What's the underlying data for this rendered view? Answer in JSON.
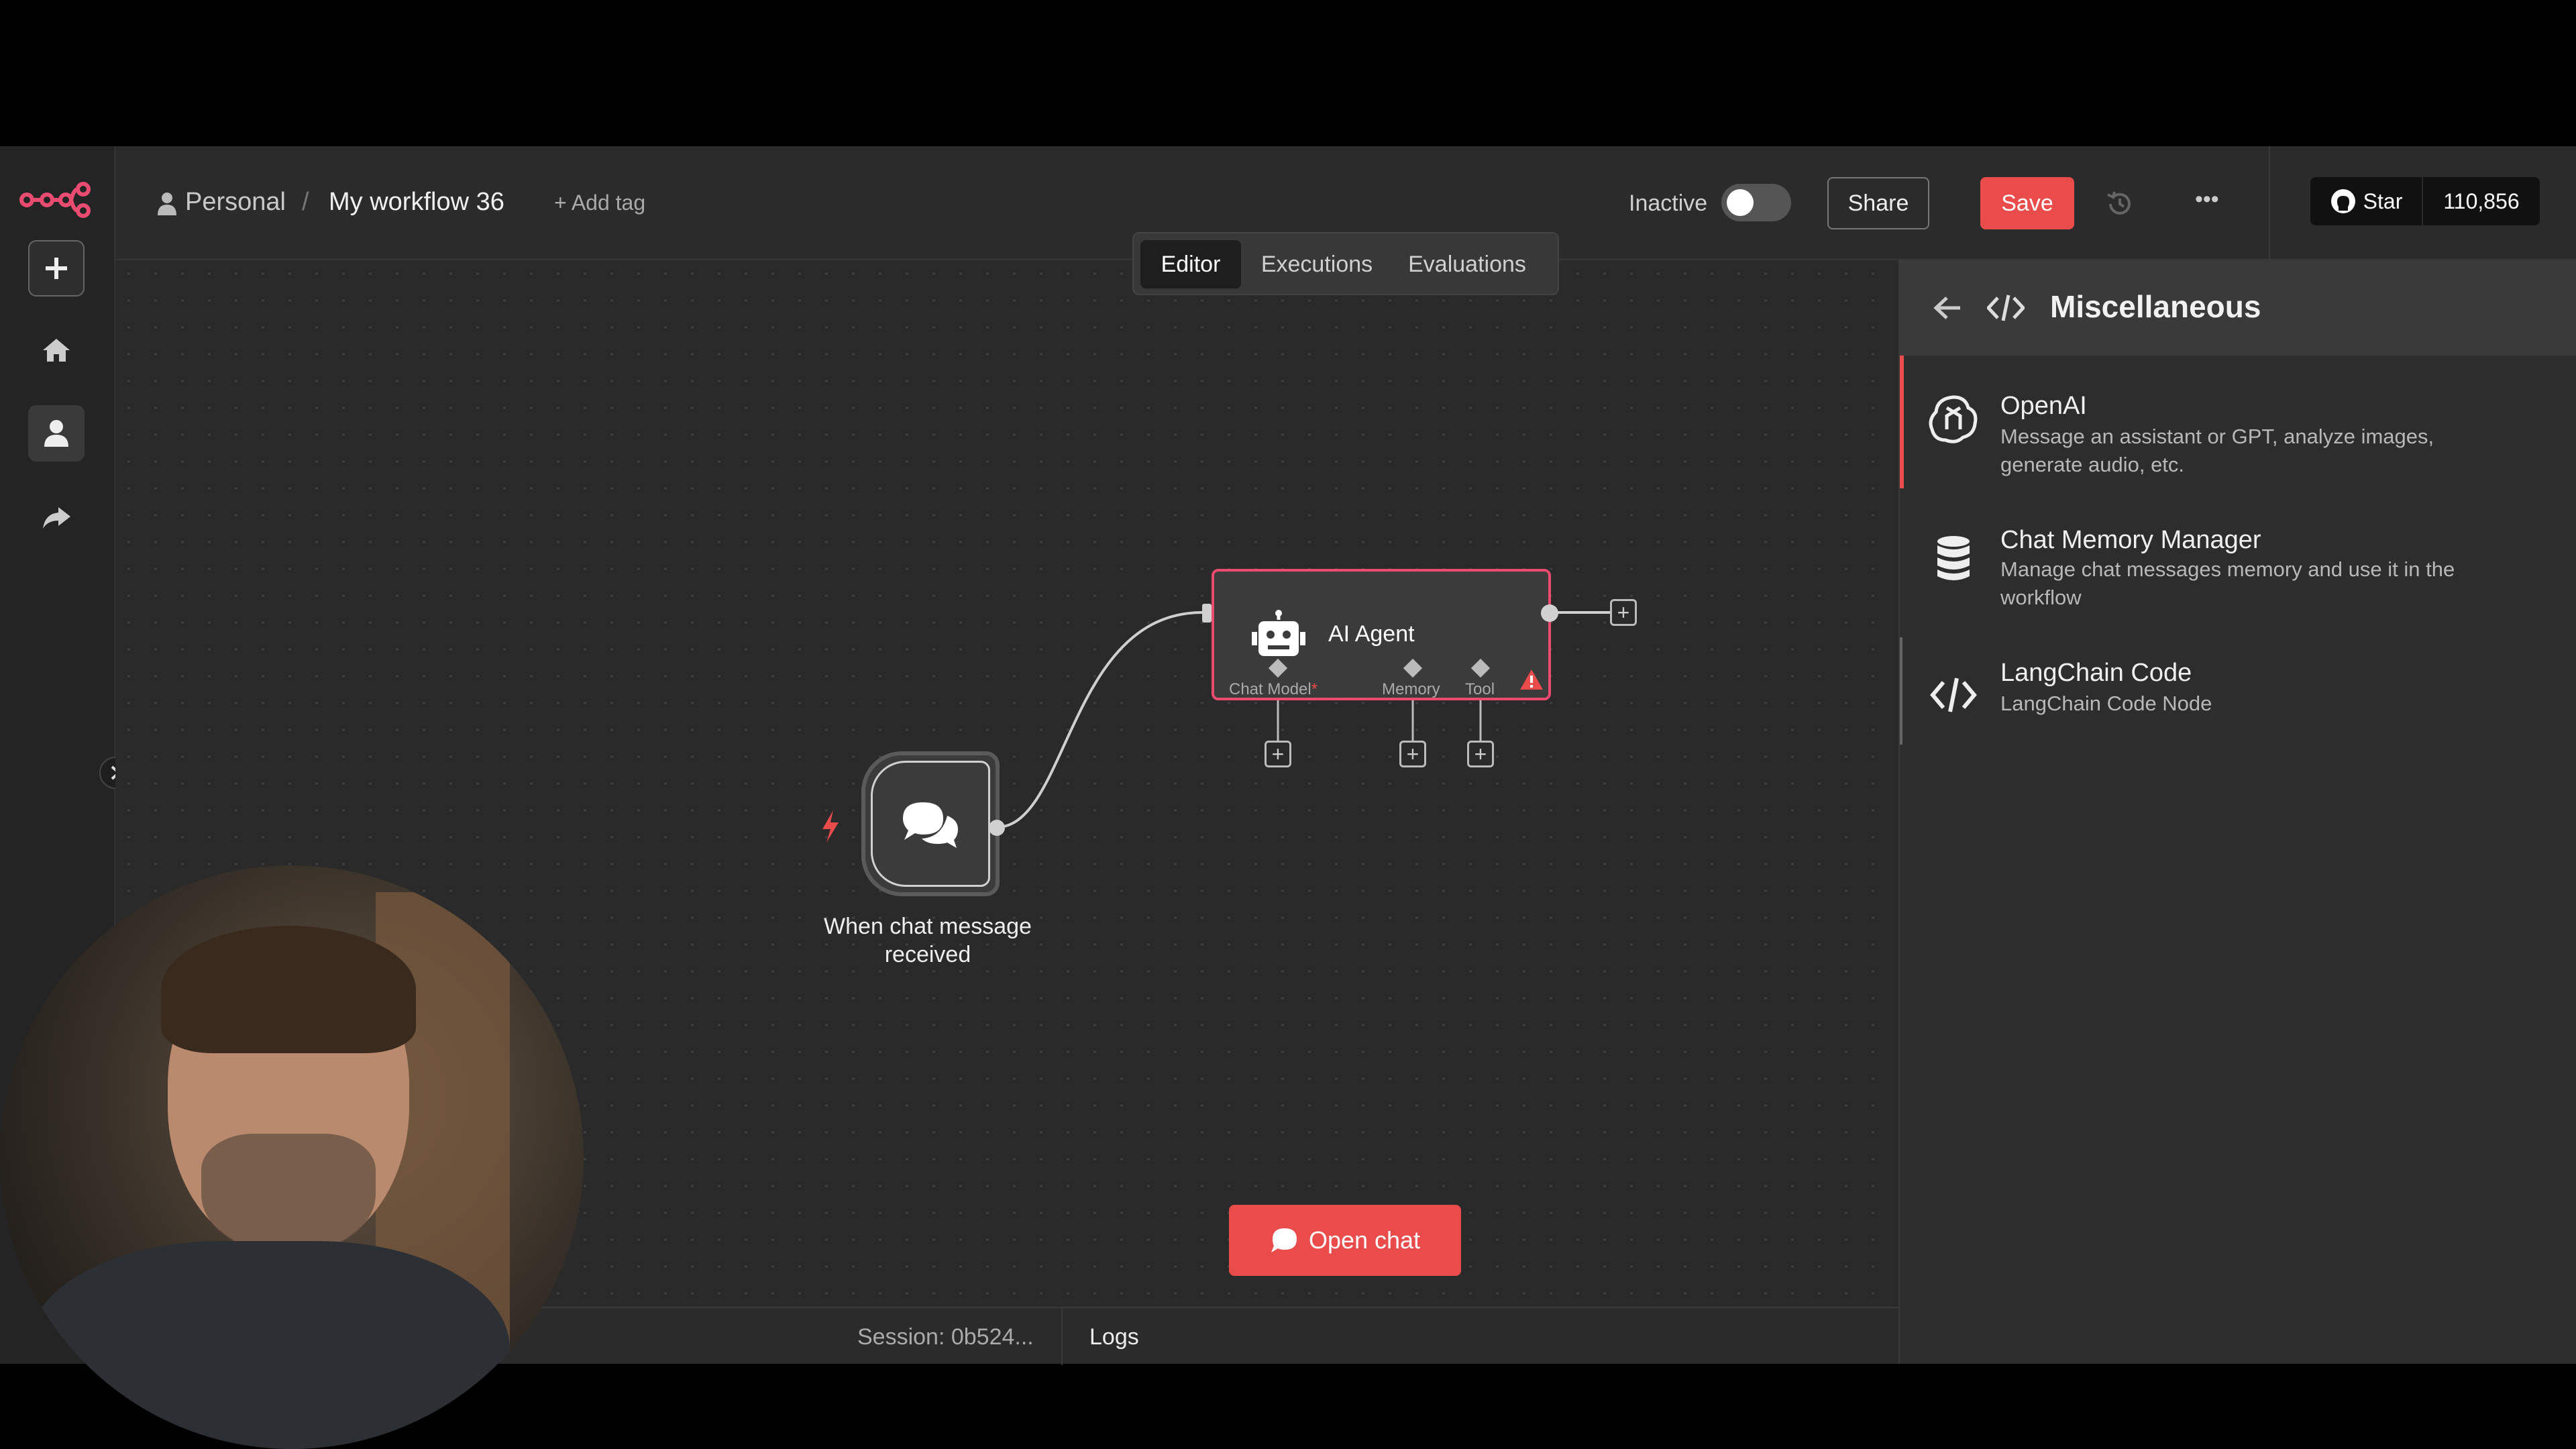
{
  "breadcrumb": {
    "owner": "Personal",
    "separator": "/",
    "workflow": "My workflow 36",
    "add_tag": "+ Add tag"
  },
  "status": {
    "label": "Inactive",
    "active": false
  },
  "buttons": {
    "share": "Share",
    "save": "Save",
    "more": "•••"
  },
  "github": {
    "star_label": "Star",
    "count": "110,856"
  },
  "tabs": [
    {
      "label": "Editor",
      "active": true
    },
    {
      "label": "Executions",
      "active": false
    },
    {
      "label": "Evaluations",
      "active": false
    }
  ],
  "panel": {
    "title": "Miscellaneous",
    "items": [
      {
        "title": "OpenAI",
        "description": "Message an assistant or GPT, analyze images, generate audio, etc.",
        "icon": "openai-icon"
      },
      {
        "title": "Chat Memory Manager",
        "description": "Manage chat messages memory and use it in the workflow",
        "icon": "database-icon"
      },
      {
        "title": "LangChain Code",
        "description": "LangChain Code Node",
        "icon": "code-icon"
      }
    ]
  },
  "nodes": {
    "trigger": {
      "label": "When chat message received"
    },
    "agent": {
      "label": "AI Agent",
      "ports": {
        "chat_model": "Chat Model",
        "required_mark": "*",
        "memory": "Memory",
        "tool": "Tool"
      }
    }
  },
  "bottom": {
    "open_chat": "Open chat",
    "session": "Session: 0b524...",
    "logs": "Logs"
  },
  "colors": {
    "accent": "#ea4b4b",
    "brand": "#ea4b71",
    "background": "#2a2a2a"
  }
}
